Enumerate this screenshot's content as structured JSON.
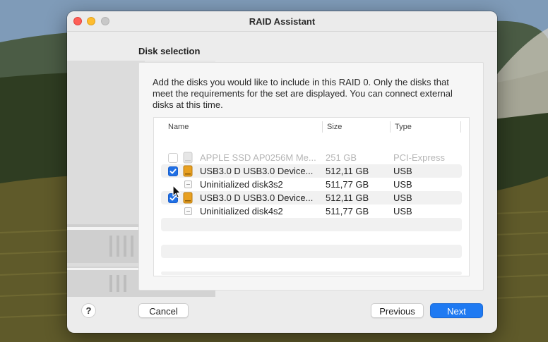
{
  "window": {
    "title": "RAID Assistant"
  },
  "section": {
    "heading": "Disk selection",
    "description": "Add the disks you would like to include in this RAID 0. Only the disks that meet the requirements for the set are displayed. You can connect external disks at this time."
  },
  "table": {
    "columns": [
      "Name",
      "Size",
      "Type"
    ],
    "rows": [
      {
        "name": "APPLE SSD AP0256M Me...",
        "size": "251 GB",
        "type": "PCI-Express",
        "kind": "disk",
        "checked": false,
        "disabled": true
      },
      {
        "name": "USB3.0 D USB3.0 Device...",
        "size": "512,11 GB",
        "type": "USB",
        "kind": "disk",
        "checked": true,
        "disabled": false
      },
      {
        "name": "Uninitialized disk3s2",
        "size": "511,77 GB",
        "type": "USB",
        "kind": "partition",
        "disabled": false
      },
      {
        "name": "USB3.0 D USB3.0 Device...",
        "size": "512,11 GB",
        "type": "USB",
        "kind": "disk",
        "checked": true,
        "disabled": false
      },
      {
        "name": "Uninitialized disk4s2",
        "size": "511,77 GB",
        "type": "USB",
        "kind": "partition",
        "disabled": false
      }
    ]
  },
  "buttons": {
    "help": "?",
    "cancel": "Cancel",
    "previous": "Previous",
    "next": "Next"
  },
  "colors": {
    "accent": "#1f7af2",
    "checkbox": "#1f6fe5",
    "usb_disk": "#e8a020"
  }
}
